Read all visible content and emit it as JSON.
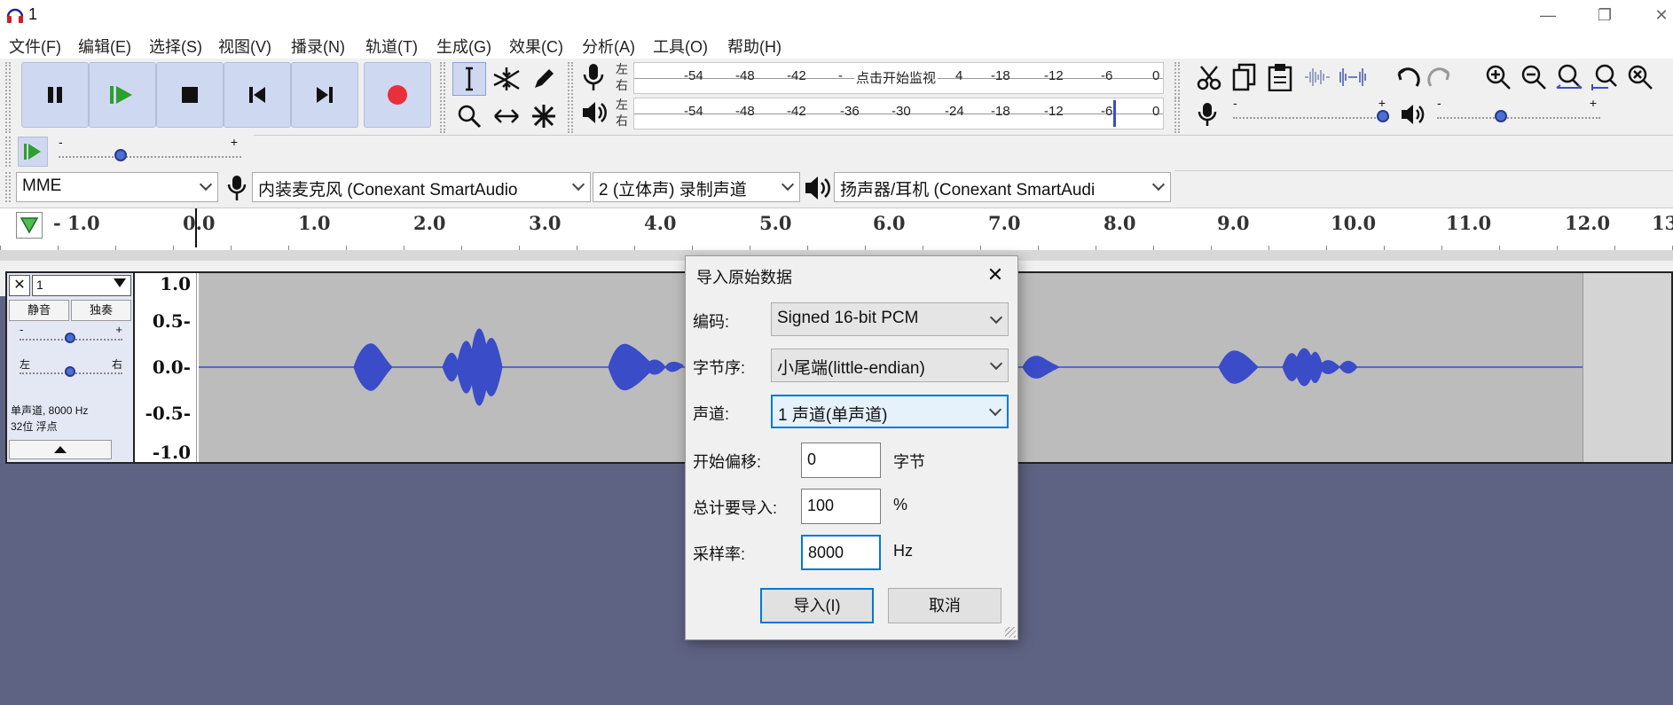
{
  "window": {
    "title": "1",
    "icon": "headphones-icon",
    "controls": [
      "minimize-icon",
      "restore-icon",
      "close-icon"
    ]
  },
  "menu": [
    "文件(F)",
    "编辑(E)",
    "选择(S)",
    "视图(V)",
    "播录(N)",
    "轨道(T)",
    "生成(G)",
    "效果(C)",
    "分析(A)",
    "工具(O)",
    "帮助(H)"
  ],
  "transport": {
    "buttons": [
      "pause-icon",
      "play-icon",
      "stop-icon",
      "skip-start-icon",
      "skip-end-icon",
      "record-icon"
    ],
    "colors": {
      "button_bg": "#cfd8f1",
      "record": "#e8303b",
      "play": "#2ca02c"
    }
  },
  "tools": {
    "row1": [
      "selection-cursor-icon",
      "envelope-tool-icon",
      "draw-pencil-icon"
    ],
    "row2": [
      "zoom-tool-icon",
      "time-shift-icon",
      "multi-tool-icon"
    ]
  },
  "meters": {
    "record": {
      "lr_top": "左",
      "lr_bottom": "右",
      "ticks": [
        "-54",
        "-48",
        "-42",
        "-",
        "4",
        "-18",
        "-12",
        "-6",
        "0"
      ],
      "prompt": "点击开始监视"
    },
    "playback": {
      "lr_top": "左",
      "lr_bottom": "右",
      "ticks": [
        "-54",
        "-48",
        "-42",
        "-36",
        "-30",
        "-24",
        "-18",
        "-12",
        "-6",
        "0"
      ]
    }
  },
  "edit_toolbar": [
    "cut-icon",
    "copy-icon",
    "paste-icon",
    "trim-icon",
    "silence-icon",
    "undo-icon",
    "redo-icon",
    "zoom-in-icon",
    "zoom-out-icon",
    "fit-selection-icon",
    "fit-project-icon",
    "zoom-toggle-icon"
  ],
  "mixer": {
    "record_min": "-",
    "record_max": "+",
    "play_min": "-",
    "play_max": "+",
    "record_volume": 1.0,
    "play_volume": 0.38
  },
  "play_at_speed": {
    "min": "-",
    "max": "+",
    "speed": 0.33
  },
  "devices": {
    "host": "MME",
    "input": "内装麦克风 (Conexant SmartAudio",
    "channels": "2 (立体声) 录制声道",
    "output": "扬声器/耳机 (Conexant SmartAudi"
  },
  "ruler": {
    "ticks": [
      "- 1.0",
      "0.0",
      "1.0",
      "2.0",
      "3.0",
      "4.0",
      "5.0",
      "6.0",
      "7.0",
      "8.0",
      "9.0",
      "10.0",
      "11.0",
      "12.0",
      "13"
    ]
  },
  "track": {
    "name": "1",
    "mute": "静音",
    "solo": "独奏",
    "gain_min": "-",
    "gain_max": "+",
    "pan_left": "左",
    "pan_right": "右",
    "gain": 0.5,
    "pan": 0.5,
    "info_line1": "单声道, 8000 Hz",
    "info_line2": "32位 浮点",
    "scale": [
      "1.0",
      "0.5-",
      "0.0-",
      "-0.5-",
      "-1.0"
    ],
    "colors": {
      "wave": "#3a4cc8",
      "bg": "#bcbcbc",
      "panel": "#e4e8f5"
    }
  },
  "dialog": {
    "title": "导入原始数据",
    "encoding_label": "编码:",
    "encoding_value": "Signed 16-bit PCM",
    "byte_order_label": "字节序:",
    "byte_order_value": "小尾端(little-endian)",
    "channels_label": "声道:",
    "channels_value": "1 声道(单声道)",
    "offset_label": "开始偏移:",
    "offset_value": "0",
    "offset_unit": "字节",
    "amount_label": "总计要导入:",
    "amount_value": "100",
    "amount_unit": "%",
    "rate_label": "采样率:",
    "rate_value": "8000",
    "rate_unit": "Hz",
    "import_button": "导入(I)",
    "cancel_button": "取消"
  }
}
